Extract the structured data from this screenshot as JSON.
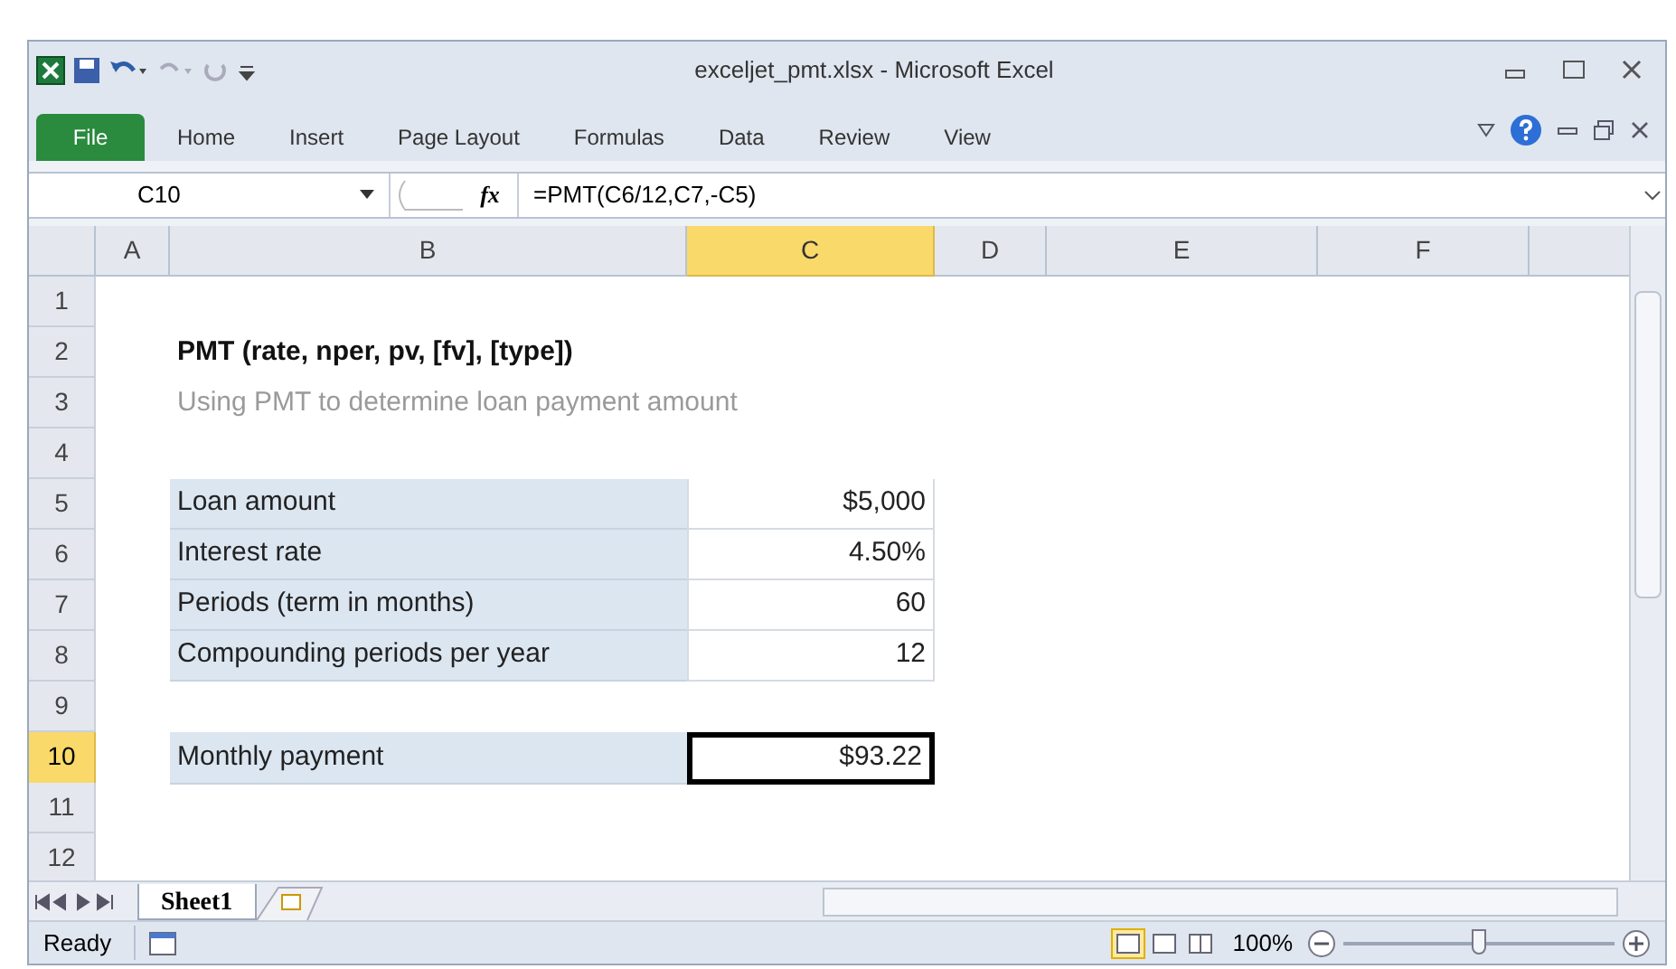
{
  "window": {
    "title": "exceljet_pmt.xlsx - Microsoft Excel"
  },
  "ribbon_tabs": [
    {
      "label": "File",
      "kind": "file",
      "selected": false
    },
    {
      "label": "Home",
      "kind": "tab",
      "selected": false
    },
    {
      "label": "Insert",
      "kind": "tab",
      "selected": false
    },
    {
      "label": "Page Layout",
      "kind": "tab",
      "selected": false
    },
    {
      "label": "Formulas",
      "kind": "tab",
      "selected": false
    },
    {
      "label": "Data",
      "kind": "tab",
      "selected": false
    },
    {
      "label": "Review",
      "kind": "tab",
      "selected": false
    },
    {
      "label": "View",
      "kind": "tab",
      "selected": false
    }
  ],
  "name_box": "C10",
  "formula_bar": {
    "fx": "fx",
    "formula": "=PMT(C6/12,C7,-C5)"
  },
  "columns": [
    {
      "label": "A",
      "selected": false
    },
    {
      "label": "B",
      "selected": false
    },
    {
      "label": "C",
      "selected": true
    },
    {
      "label": "D",
      "selected": false
    },
    {
      "label": "E",
      "selected": false
    },
    {
      "label": "F",
      "selected": false
    }
  ],
  "rows": [
    {
      "number": "1",
      "selected": false
    },
    {
      "number": "2",
      "selected": false,
      "cells": [
        {
          "kind": "title",
          "text": "PMT (rate, nper, pv, [fv], [type])"
        }
      ]
    },
    {
      "number": "3",
      "selected": false,
      "cells": [
        {
          "kind": "subtitle",
          "text": "Using PMT to determine loan payment amount"
        }
      ]
    },
    {
      "number": "4",
      "selected": false
    },
    {
      "number": "5",
      "selected": false,
      "cells": [
        {
          "kind": "label",
          "text": "Loan amount"
        },
        {
          "kind": "value",
          "text": "$5,000",
          "selected": false
        }
      ]
    },
    {
      "number": "6",
      "selected": false,
      "cells": [
        {
          "kind": "label",
          "text": "Interest rate"
        },
        {
          "kind": "value",
          "text": "4.50%",
          "selected": false
        }
      ]
    },
    {
      "number": "7",
      "selected": false,
      "cells": [
        {
          "kind": "label",
          "text": "Periods (term in months)"
        },
        {
          "kind": "value",
          "text": "60",
          "selected": false
        }
      ]
    },
    {
      "number": "8",
      "selected": false,
      "cells": [
        {
          "kind": "label",
          "text": "Compounding periods per year"
        },
        {
          "kind": "value",
          "text": "12",
          "selected": false
        }
      ]
    },
    {
      "number": "9",
      "selected": false
    },
    {
      "number": "10",
      "selected": true,
      "cells": [
        {
          "kind": "label",
          "text": "Monthly payment"
        },
        {
          "kind": "value",
          "text": "$93.22",
          "selected": true
        }
      ]
    },
    {
      "number": "11",
      "selected": false
    },
    {
      "number": "12",
      "selected": false
    }
  ],
  "sheet_tabs": [
    {
      "label": "Sheet1",
      "selected": true
    }
  ],
  "status_bar": {
    "status": "Ready",
    "zoom": "100%",
    "zoom_level": {
      "level": 0.5
    }
  }
}
